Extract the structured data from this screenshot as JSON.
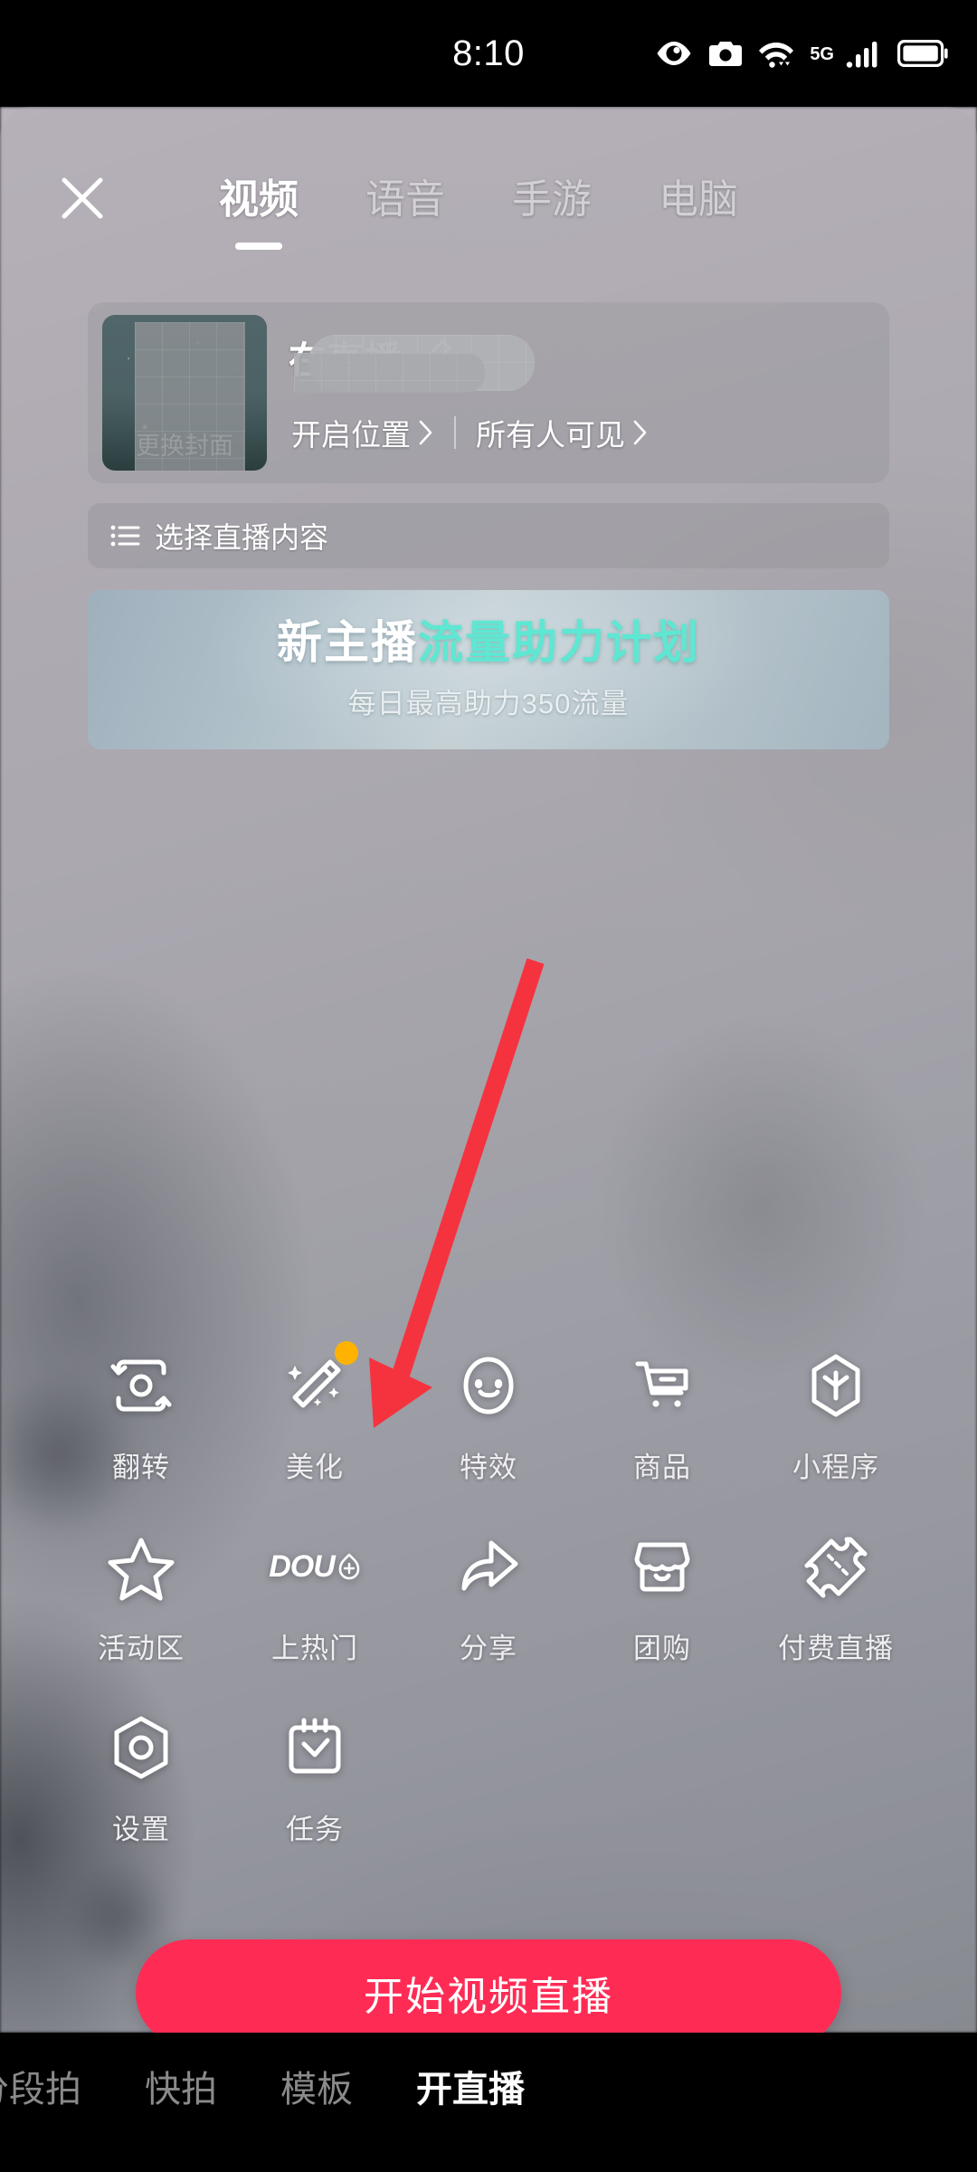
{
  "status_bar": {
    "time": "8:10",
    "network_label": "5G",
    "icons": [
      "eye-icon",
      "camera-icon",
      "wifi-icon",
      "signal-icon",
      "battery-icon"
    ]
  },
  "header": {
    "close_icon": "close-icon",
    "tabs": [
      {
        "label": "视频",
        "active": true
      },
      {
        "label": "语音",
        "active": false
      },
      {
        "label": "手游",
        "active": false
      },
      {
        "label": "电脑",
        "active": false
      }
    ]
  },
  "title_card": {
    "cover_label": "更换封面",
    "room_title": "在直播",
    "edit_icon": "pencil-icon",
    "location_label": "开启位置",
    "visibility_label": "所有人可见",
    "chevron_icon": "chevron-right-icon"
  },
  "content_select": {
    "icon": "list-icon",
    "label": "选择直播内容"
  },
  "promo_banner": {
    "title_part1": "新主播",
    "title_part2": "流量助力计划",
    "subtitle": "每日最高助力350流量",
    "accent_color": "#5ee7d2"
  },
  "tools": [
    {
      "label": "翻转",
      "icon": "flip-camera-icon",
      "badge": false
    },
    {
      "label": "美化",
      "icon": "magic-wand-icon",
      "badge": true
    },
    {
      "label": "特效",
      "icon": "smiley-face-icon",
      "badge": false
    },
    {
      "label": "商品",
      "icon": "shopping-cart-icon",
      "badge": false
    },
    {
      "label": "小程序",
      "icon": "mini-program-icon",
      "badge": false
    },
    {
      "label": "活动区",
      "icon": "star-icon",
      "badge": false
    },
    {
      "label": "上热门",
      "icon": "dou-plus-icon",
      "badge": false
    },
    {
      "label": "分享",
      "icon": "share-arrow-icon",
      "badge": false
    },
    {
      "label": "团购",
      "icon": "storefront-icon",
      "badge": false
    },
    {
      "label": "付费直播",
      "icon": "ticket-icon",
      "badge": false
    },
    {
      "label": "设置",
      "icon": "settings-icon",
      "badge": false
    },
    {
      "label": "任务",
      "icon": "task-calendar-icon",
      "badge": false
    }
  ],
  "dou_plus_logo_text": "DOU",
  "start_button": {
    "label": "开始视频直播",
    "color": "#FE2C55"
  },
  "bottom_nav": [
    {
      "label": "分段拍",
      "active": false,
      "clipped": true
    },
    {
      "label": "快拍",
      "active": false,
      "clipped": false
    },
    {
      "label": "模板",
      "active": false,
      "clipped": false
    },
    {
      "label": "开直播",
      "active": true,
      "clipped": false
    }
  ],
  "annotation": {
    "type": "arrow",
    "color": "#F5333F",
    "points_to": "上热门"
  }
}
